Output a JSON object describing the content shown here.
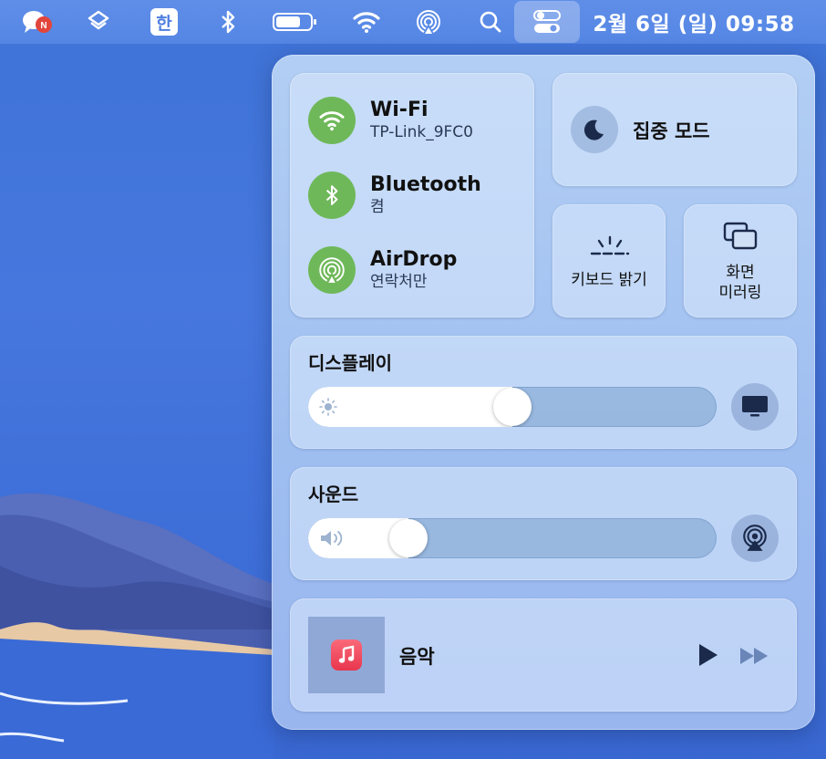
{
  "menubar": {
    "han_label": "한",
    "clock": "2월 6일 (일)  09:58"
  },
  "control_center": {
    "wifi": {
      "title": "Wi-Fi",
      "network": "TP-Link_9FC0"
    },
    "bluetooth": {
      "title": "Bluetooth",
      "status": "켬"
    },
    "airdrop": {
      "title": "AirDrop",
      "status": "연락처만"
    },
    "focus": {
      "label": "집중 모드"
    },
    "keyboard_brightness": {
      "label": "키보드 밝기"
    },
    "screen_mirroring": {
      "label_line1": "화면",
      "label_line2": "미러링"
    },
    "display": {
      "title": "디스플레이",
      "brightness": 0.5
    },
    "sound": {
      "title": "사운드",
      "volume": 0.22
    },
    "music": {
      "title": "음악"
    }
  },
  "colors": {
    "connected_green": "#6fb85a",
    "desktop_blue": "#4677de",
    "music_red": "#e8364e"
  },
  "icons": {
    "menubar": [
      "messages-icon",
      "stack-icon",
      "input-source-icon",
      "bluetooth-icon",
      "battery-icon",
      "wifi-icon",
      "airdrop-icon",
      "search-icon",
      "control-center-icon"
    ],
    "tiles": [
      "wifi-icon",
      "bluetooth-icon",
      "airdrop-icon",
      "moon-icon",
      "keyboard-brightness-icon",
      "screen-mirroring-icon",
      "sun-icon",
      "display-icon",
      "speaker-icon",
      "airplay-audio-icon",
      "music-app-icon",
      "play-icon",
      "fast-forward-icon"
    ]
  }
}
